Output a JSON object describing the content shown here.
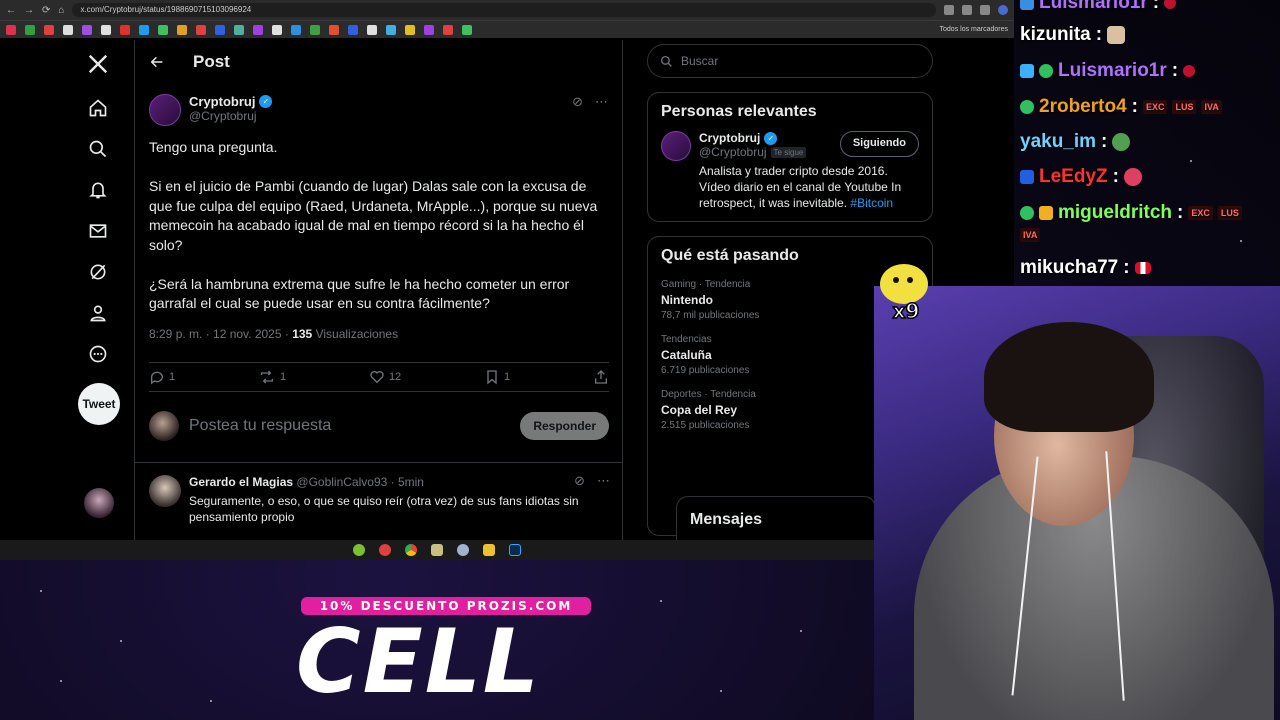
{
  "browser": {
    "url": "x.com/Cryptobruj/status/1988690715103096924",
    "bookmarks_label": "Todos los marcadores"
  },
  "nav": {
    "tweet_button": "Tweet"
  },
  "post": {
    "header_title": "Post",
    "author_name": "Cryptobruj",
    "author_handle": "@Cryptobruj",
    "paragraphs": [
      "Tengo una pregunta.",
      "Si en el juicio de Pambi (cuando de lugar) Dalas sale con la excusa de que fue culpa del equipo (Raed, Urdaneta, MrApple...), porque su nueva memecoin ha acabado igual de mal en tiempo récord si la ha hecho él solo?",
      "¿Será la hambruna extrema que sufre le ha hecho cometer un error garrafal el cual se puede usar en su contra fácilmente?"
    ],
    "time": "8:29 p. m. · 12 nov. 2025 · ",
    "views_count": "135",
    "views_label": " Visualizaciones",
    "counts": {
      "replies": "1",
      "reposts": "1",
      "likes": "12",
      "bookmarks": "1"
    },
    "reply_placeholder": "Postea tu respuesta",
    "reply_button": "Responder"
  },
  "reply": {
    "name": "Gerardo el Magias",
    "handle": "@GoblinCalvo93 · 5min",
    "text": "Seguramente, o eso, o que se quiso reír (otra vez) de sus fans idiotas sin pensamiento propio"
  },
  "sidebar": {
    "search_placeholder": "Buscar",
    "relevant_title": "Personas relevantes",
    "relevant": {
      "name": "Cryptobruj",
      "handle": "@Cryptobruj",
      "follows_you": "Te sigue",
      "follow_button": "Siguiendo",
      "bio": "Analista y trader cripto desde 2016. Vídeo diario en el canal de Youtube In retrospect, it was inevitable. ",
      "bio_hashtag": "#Bitcoin"
    },
    "trends_title": "Qué está pasando",
    "trends": [
      {
        "category": "Gaming · Tendencia",
        "name": "Nintendo",
        "posts": "78,7 mil publicaciones"
      },
      {
        "category": "Tendencias",
        "name": "Cataluña",
        "posts": "6.719 publicaciones"
      },
      {
        "category": "Deportes · Tendencia",
        "name": "Copa del Rey",
        "posts": "2.515 publicaciones"
      }
    ],
    "messages_label": "Mensajes"
  },
  "chat": [
    {
      "user": "Luismario1r",
      "color": "#b070ff"
    },
    {
      "user": "kizunita",
      "color": "#ffffff"
    },
    {
      "user": "Luismario1r",
      "color": "#b070ff"
    },
    {
      "user": "2roberto4",
      "color": "#f0a020"
    },
    {
      "user": "yaku_im",
      "color": "#6ad4ff"
    },
    {
      "user": "LeEdyZ",
      "color": "#ff3030"
    },
    {
      "user": "migueldritch",
      "color": "#7dff5a"
    },
    {
      "user": "mikucha77",
      "color": "#ffffff"
    }
  ],
  "chat_tags": {
    "exc": "EXC",
    "lus": "LUS",
    "iva": "IVA"
  },
  "overlay": {
    "promo": "10% DESCUENTO PROZIS.COM",
    "big_word": "CELL",
    "emote_count": "x9"
  },
  "colors": {
    "accent": "#1d9bf0",
    "background": "#000000",
    "promo": "#e0209f"
  }
}
